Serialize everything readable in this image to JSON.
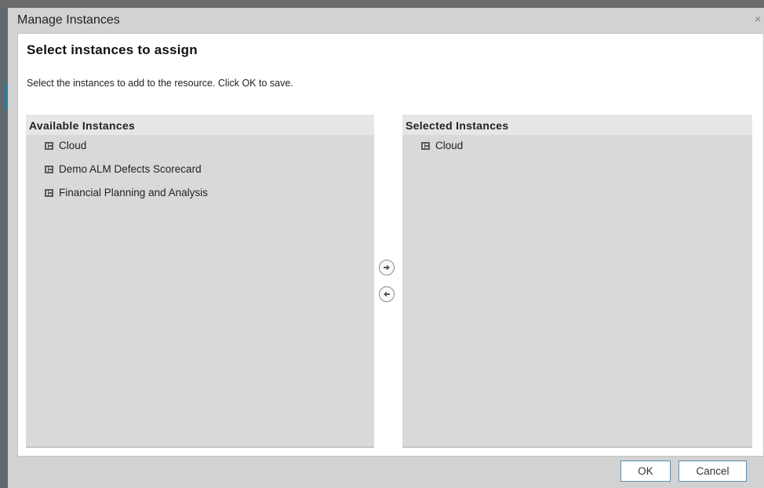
{
  "dialog": {
    "title": "Manage Instances",
    "close_icon": "close-icon",
    "close_glyph": "×"
  },
  "content": {
    "section_title": "Select instances to assign",
    "instructions": "Select the instances to add to the resource. Click OK to save."
  },
  "available": {
    "header": "Available Instances",
    "items": [
      {
        "label": "Cloud",
        "icon": "instance-icon"
      },
      {
        "label": "Demo ALM Defects Scorecard",
        "icon": "instance-icon"
      },
      {
        "label": "Financial Planning and Analysis",
        "icon": "instance-icon"
      }
    ]
  },
  "selected": {
    "header": "Selected Instances",
    "items": [
      {
        "label": "Cloud",
        "icon": "instance-icon"
      }
    ]
  },
  "move": {
    "add_icon": "arrow-right-icon",
    "remove_icon": "arrow-left-icon"
  },
  "footer": {
    "ok_label": "OK",
    "cancel_label": "Cancel"
  },
  "colors": {
    "dialog_bg": "#d2d2d2",
    "panel_bg": "#d9d9d9",
    "panel_header_bg": "#e6e6e6",
    "button_border": "#5f8fb0"
  }
}
